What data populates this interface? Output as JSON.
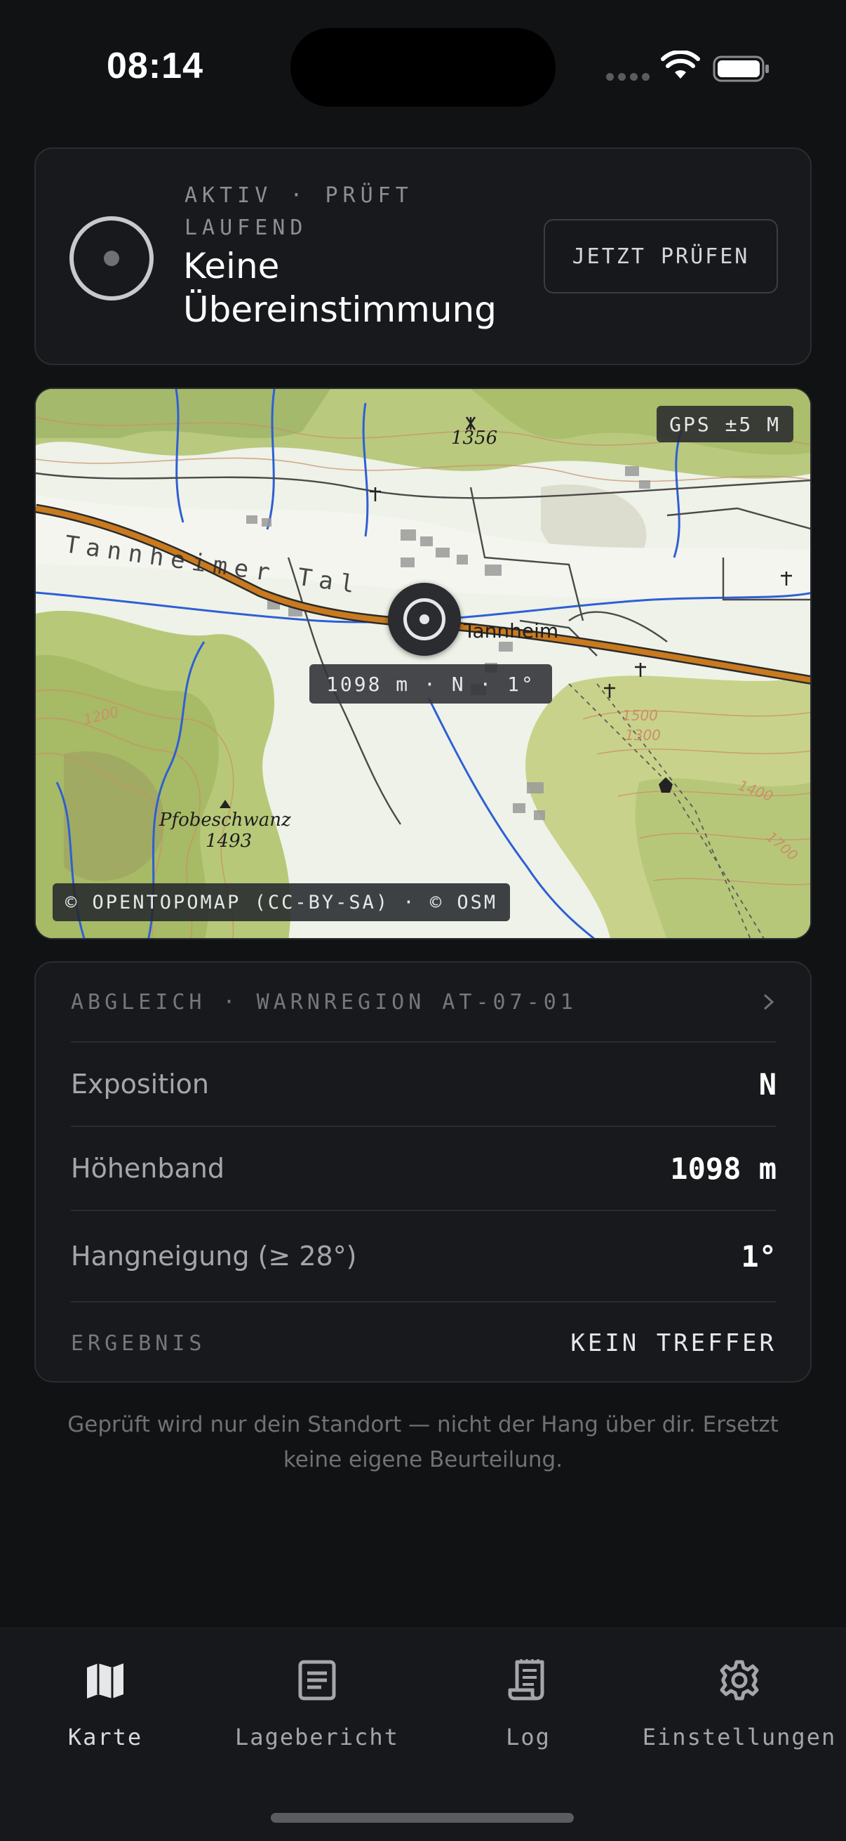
{
  "status_bar": {
    "time": "08:14"
  },
  "status_card": {
    "kicker": "AKTIV · PRÜFT LAUFEND",
    "title": "Keine Übereinstimmung",
    "check_button": "JETZT PRÜFEN"
  },
  "map": {
    "gps_accuracy": "GPS ±5 M",
    "location_readout": "1098 m · N · 1°",
    "attribution": "© OPENTOPOMAP (CC-BY-SA) · © OSM",
    "labels": {
      "peak_north_elevation": "1356",
      "town": "Tannheim",
      "valley": "Tannheimer Tal",
      "peak_southwest_name": "Pfobeschwanz",
      "peak_southwest_elevation": "1493",
      "contour_1200": "1200",
      "contour_1300": "1300",
      "contour_1400": "1400",
      "contour_1500": "1500",
      "contour_1700": "1700"
    }
  },
  "comparison": {
    "header": "ABGLEICH · WARNREGION AT-07-01",
    "rows": [
      {
        "label": "Exposition",
        "value": "N"
      },
      {
        "label": "Höhenband",
        "value": "1098 m"
      },
      {
        "label": "Hangneigung (≥ 28°)",
        "value": "1°"
      }
    ],
    "result_label": "ERGEBNIS",
    "result_value": "KEIN TREFFER"
  },
  "disclaimer": "Geprüft wird nur dein Standort — nicht der Hang über dir. Ersetzt keine eigene Beurteilung.",
  "tab_bar": {
    "tabs": [
      {
        "label": "Karte",
        "icon": "map-icon",
        "active": true
      },
      {
        "label": "Lagebericht",
        "icon": "report-icon",
        "active": false
      },
      {
        "label": "Log",
        "icon": "log-icon",
        "active": false
      },
      {
        "label": "Einstellungen",
        "icon": "gear-icon",
        "active": false
      }
    ]
  },
  "colors": {
    "background": "#111214",
    "card": "#17191c",
    "border": "#2a2d31",
    "road": "#c97a1e",
    "water": "#2f5fd6"
  }
}
